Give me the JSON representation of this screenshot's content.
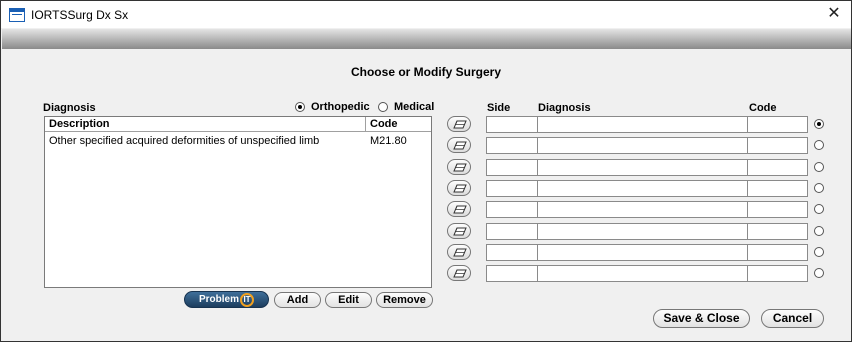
{
  "window": {
    "title": "IORTSSurg Dx Sx",
    "close_glyph": "✕"
  },
  "heading": "Choose or Modify Surgery",
  "diagnosis": {
    "label": "Diagnosis",
    "radio_orthopedic": "Orthopedic",
    "radio_medical": "Medical",
    "selected_type": "Orthopedic",
    "columns": [
      "Description",
      "Code"
    ],
    "rows": [
      {
        "description": "Other specified acquired deformities of unspecified limb",
        "code": "M21.80"
      }
    ]
  },
  "buttons": {
    "problem_it_label": "Problem",
    "problem_it_badge": "IT",
    "add": "Add",
    "edit": "Edit",
    "remove": "Remove",
    "save_close": "Save & Close",
    "cancel": "Cancel"
  },
  "surgery_grid": {
    "headers": {
      "side": "Side",
      "diagnosis": "Diagnosis",
      "code": "Code"
    },
    "row_count": 8,
    "selected_row": 1
  },
  "icons": {
    "erase": "eraser-icon",
    "window": "table-icon"
  }
}
